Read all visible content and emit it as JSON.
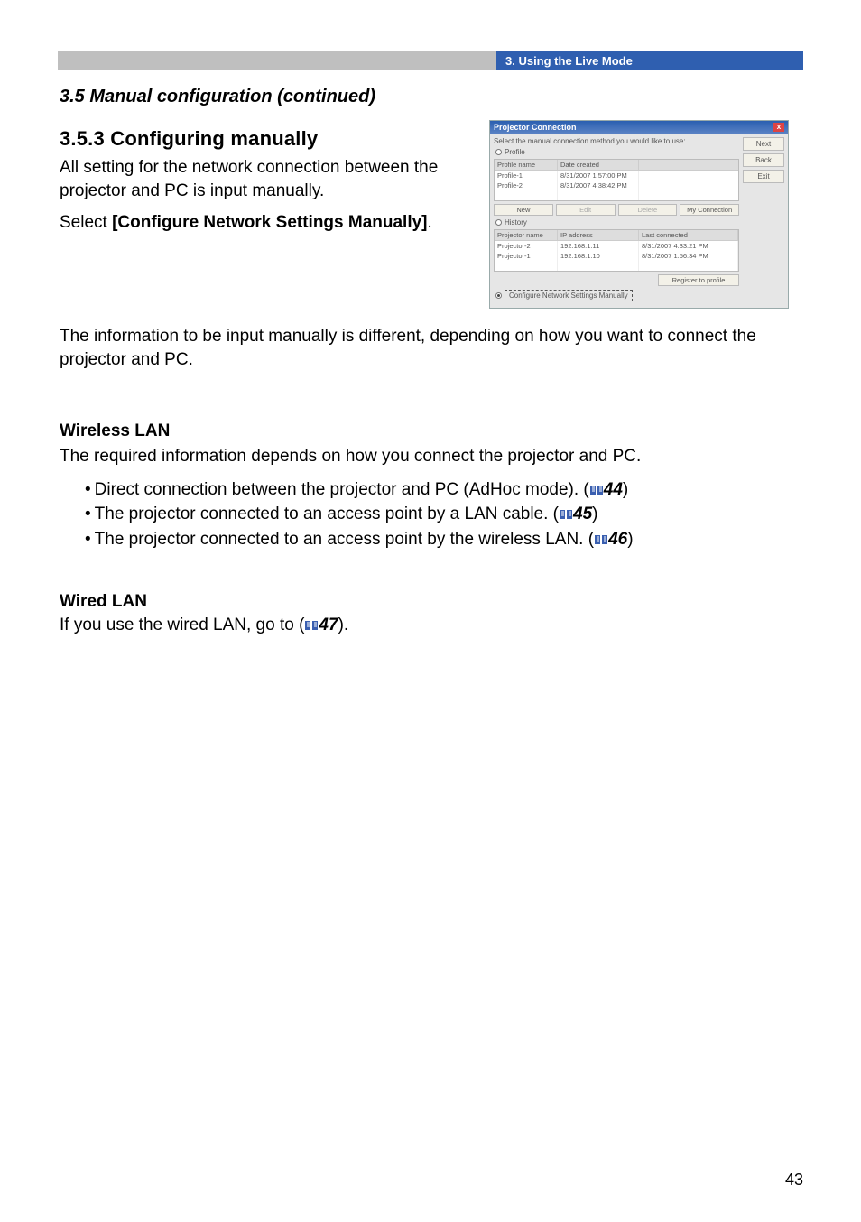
{
  "header": {
    "breadcrumb": "3. Using the Live Mode"
  },
  "headings": {
    "subtitle": "3.5 Manual configuration (continued)",
    "section": "3.5.3 Configuring manually"
  },
  "intro": {
    "p1": "All setting for the network connection between the projector and PC is input manually.",
    "p2a": "Select ",
    "p2b": "[Configure Network Settings Manually]",
    "p2c": "."
  },
  "after_dialog": {
    "p": "The information to be input manually is different, depending on how you want to connect the projector and PC."
  },
  "wlan": {
    "heading": "Wireless LAN",
    "intro": "The required information depends on how you connect the projector and PC.",
    "items": [
      {
        "text": "Direct connection between the projector and PC (AdHoc mode). (",
        "ref": "44",
        "close": ")"
      },
      {
        "text": "The projector connected to an access point by a LAN cable. (",
        "ref": "45",
        "close": ")"
      },
      {
        "text": "The projector connected to an access point by the wireless LAN. (",
        "ref": "46",
        "close": ")"
      }
    ]
  },
  "wired": {
    "heading": "Wired LAN",
    "line_a": "If you use the wired LAN, go to (",
    "ref": "47",
    "line_b": ")."
  },
  "page_number": "43",
  "dialog": {
    "title": "Projector Connection",
    "instruction": "Select the manual connection method you would like to use:",
    "radio_profile": "Profile",
    "radio_history": "History",
    "radio_manual": "Configure Network Settings Manually",
    "buttons": {
      "next": "Next",
      "back": "Back",
      "exit": "Exit"
    },
    "profile_cols": {
      "a": "Profile name",
      "b": "Date created"
    },
    "profiles": [
      {
        "a": "Profile-1",
        "b": "8/31/2007 1:57:00 PM"
      },
      {
        "a": "Profile-2",
        "b": "8/31/2007 4:38:42 PM"
      }
    ],
    "profile_btns": {
      "new": "New",
      "edit": "Edit",
      "delete": "Delete",
      "myconn": "My Connection"
    },
    "history_cols": {
      "a": "Projector name",
      "b": "IP address",
      "c": "Last connected"
    },
    "history": [
      {
        "a": "Projector-2",
        "b": "192.168.1.11",
        "c": "8/31/2007 4:33:21 PM"
      },
      {
        "a": "Projector-1",
        "b": "192.168.1.10",
        "c": "8/31/2007 1:56:34 PM"
      }
    ],
    "register": "Register to profile"
  }
}
